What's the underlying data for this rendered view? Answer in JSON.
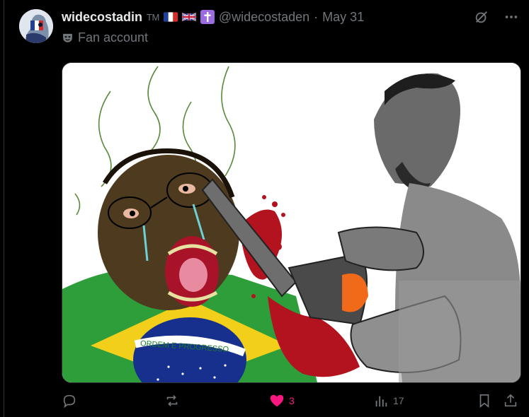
{
  "post": {
    "display_name": "widecostadin",
    "name_suffix": "TM",
    "handle": "@widecostaden",
    "separator": "·",
    "date": "May 31",
    "label": "Fan account"
  },
  "media": {
    "banner_text": "ORDEM E PROGRESSO"
  },
  "actions": {
    "reply_count": "",
    "repost_count": "",
    "like_count": "3",
    "views_count": "17"
  },
  "colors": {
    "background": "#000000",
    "text": "#e7e9ea",
    "muted": "#71767b",
    "like": "#f91880",
    "cross_badge": "#9b6be0"
  },
  "icons": [
    "grok-icon",
    "more-icon",
    "mask-icon",
    "reply-icon",
    "repost-icon",
    "heart-icon",
    "views-icon",
    "bookmark-icon",
    "share-icon"
  ]
}
